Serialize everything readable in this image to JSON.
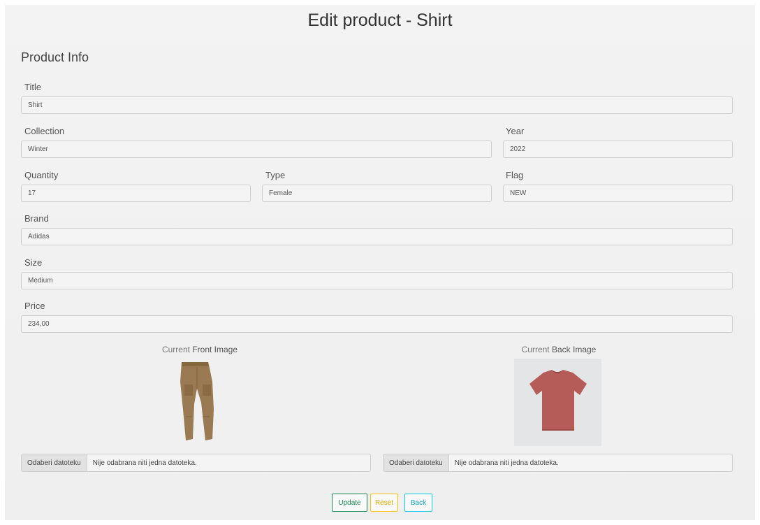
{
  "page": {
    "title": "Edit product - Shirt"
  },
  "section": {
    "title": "Product Info"
  },
  "fields": {
    "title": {
      "label": "Title",
      "value": "Shirt"
    },
    "collection": {
      "label": "Collection",
      "value": "Winter"
    },
    "year": {
      "label": "Year",
      "value": "2022"
    },
    "quantity": {
      "label": "Quantity",
      "value": "17"
    },
    "type": {
      "label": "Type",
      "value": "Female"
    },
    "flag": {
      "label": "Flag",
      "value": "NEW"
    },
    "brand": {
      "label": "Brand",
      "value": "Adidas"
    },
    "size": {
      "label": "Size",
      "value": "Medium"
    },
    "price": {
      "label": "Price",
      "value": "234,00"
    }
  },
  "images": {
    "front": {
      "caption_prefix": "Current",
      "caption_main": "Front Image"
    },
    "back": {
      "caption_prefix": "Current",
      "caption_main": "Back Image"
    }
  },
  "file_inputs": {
    "front": {
      "button": "Odaberi datoteku",
      "status": "Nije odabrana niti jedna datoteka."
    },
    "back": {
      "button": "Odaberi datoteku",
      "status": "Nije odabrana niti jedna datoteka."
    }
  },
  "actions": {
    "update": "Update",
    "reset": "Reset",
    "back": "Back"
  },
  "colors": {
    "update": "#198754",
    "reset": "#ffc107",
    "back": "#0dcaf0",
    "pants": "#9a7a52",
    "shirt": "#b65c58"
  }
}
